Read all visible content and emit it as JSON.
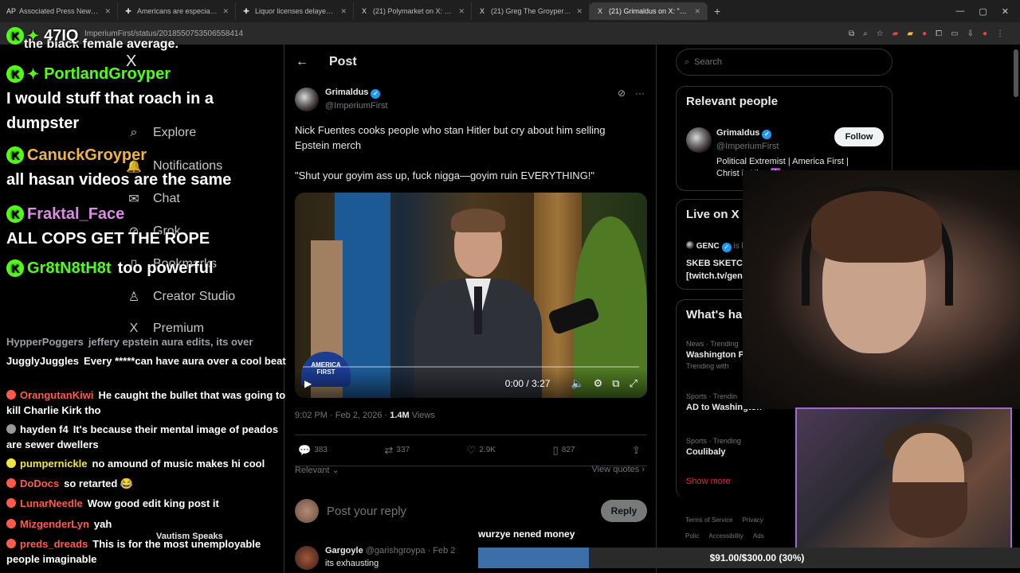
{
  "overlay_top_text": "the black female average.",
  "tabs": [
    {
      "icon": "AP",
      "title": "Associated Press News: Breaki",
      "active": false
    },
    {
      "icon": "✚",
      "title": "Americans are especially conce",
      "active": false
    },
    {
      "icon": "✚",
      "title": "Liquor licenses delayed for MN",
      "active": false
    },
    {
      "icon": "X",
      "title": "(21) Polymarket on X: \"After m",
      "active": false
    },
    {
      "icon": "X",
      "title": "(21) Greg The Groyper on X: \"I",
      "active": false
    },
    {
      "icon": "X",
      "title": "(21) Grimaldus on X: \"Nick Fue",
      "active": true
    }
  ],
  "new_tab": "+",
  "url": "ImperiumFirst/status/2018550753506558414",
  "nav": {
    "items": [
      {
        "icon": "⌕",
        "label": "Explore"
      },
      {
        "icon": "🔔",
        "label": "Notifications"
      },
      {
        "icon": "✉",
        "label": "Chat"
      },
      {
        "icon": "⊘",
        "label": "Grok"
      },
      {
        "icon": "▯",
        "label": "Bookmarks"
      },
      {
        "icon": "♙",
        "label": "Creator Studio"
      },
      {
        "icon": "X",
        "label": "Premium"
      }
    ]
  },
  "post": {
    "header_title": "Post",
    "author_name": "Grimaldus",
    "author_handle": "@ImperiumFirst",
    "text_1": "Nick Fuentes cooks people who stan Hitler but cry about him selling Epstein merch",
    "text_2": "\"Shut your goyim ass up, fuck nigga—goyim ruin EVERYTHING!\"",
    "video_time": "0:00 / 3:27",
    "hat_text": "AMERICA FIRST",
    "timestamp": "9:02 PM · Feb 2, 2026 · ",
    "views_count": "1.4M",
    "views_label": " Views",
    "replies": "383",
    "reposts": "337",
    "likes": "2.9K",
    "bookmarks": "827",
    "sort_label": "Relevant",
    "view_quotes": "View quotes",
    "reply_placeholder": "Post your reply",
    "reply_button": "Reply",
    "next_reply": {
      "name": "Gargoyle",
      "handle": "@garishgroypa · Feb 2",
      "text": "its exhausting"
    }
  },
  "sidebar": {
    "search_placeholder": "Search",
    "relevant_title": "Relevant people",
    "person": {
      "name": "Grimaldus",
      "handle": "@ImperiumFirst",
      "bio": "Political Extremist | America First | Christ is King ✝️",
      "follow": "Follow"
    },
    "live_title": "Live on X",
    "live_host": "GENC",
    "live_hosting": " is hosting",
    "live_text": "SKEB SKETCH COMMS on [twitch.tv/genczilla]",
    "happening_title": "What's happeni",
    "trends": [
      {
        "category": "News · Trending",
        "title": "Washington Po",
        "sub": "Trending with"
      },
      {
        "category": "Sports · Trendin",
        "title": "AD to Washington",
        "sub": ""
      },
      {
        "category": "Sports · Trending",
        "title": "Coulibaly",
        "sub": ""
      }
    ],
    "show_more": "Show more",
    "footer": [
      "Terms of Service",
      "Privacy Polic",
      "Accessibility",
      "Ads info",
      "Mor"
    ]
  },
  "chat_big": [
    {
      "user": "47IQ",
      "color": "#ffffff",
      "text": ""
    },
    {
      "user": "PortlandGroyper",
      "color": "#53fc18",
      "text": "I would stuff that roach in a dumpster"
    },
    {
      "user": "CanuckGroyper",
      "color": "#f0b444",
      "text": "all hasan videos are the same"
    },
    {
      "user": "Fraktal_Face",
      "color": "#d98ce0",
      "text": "ALL COPS GET THE ROPE"
    },
    {
      "user": "Gr8tN8tH8t",
      "color": "#53fc18",
      "text": "too powerful"
    }
  ],
  "chat_small": [
    {
      "user": "HypperPoggers",
      "color": "#9aa0a6",
      "text": "jeffery epstein aura edits, its over"
    },
    {
      "user": "JugglyJuggles",
      "color": "#ffffff",
      "text": "Every *****can have aura over a cool beat"
    },
    {
      "user": "OrangutanKiwi",
      "color": "#ff5b4a",
      "text": "He caught the bullet that was going to kill Charlie Kirk tho"
    },
    {
      "user": "hayden f4",
      "color": "#ffffff",
      "text": "It's because their mental image of peados are sewer dwellers"
    },
    {
      "user": "pumpernickle",
      "color": "#f0e64a",
      "text": "no amound of music makes hi cool"
    },
    {
      "user": "DoDocs",
      "color": "#ff5b4a",
      "text": "so retarted 😂"
    },
    {
      "user": "LunarNeedle",
      "color": "#ff5b4a",
      "text": "Wow good edit king post it"
    },
    {
      "user": "MizgenderLyn",
      "color": "#ff5b4a",
      "text": "yah"
    },
    {
      "user": "preds_dreads",
      "color": "#ff5b4a",
      "text": "This is for the most unemployable people imaginable"
    }
  ],
  "vautism": "Vautism Speaks",
  "goal": {
    "label": "wurzye nened money",
    "text": "$91.00/$300.00 (30%)",
    "progress": 0.3
  }
}
